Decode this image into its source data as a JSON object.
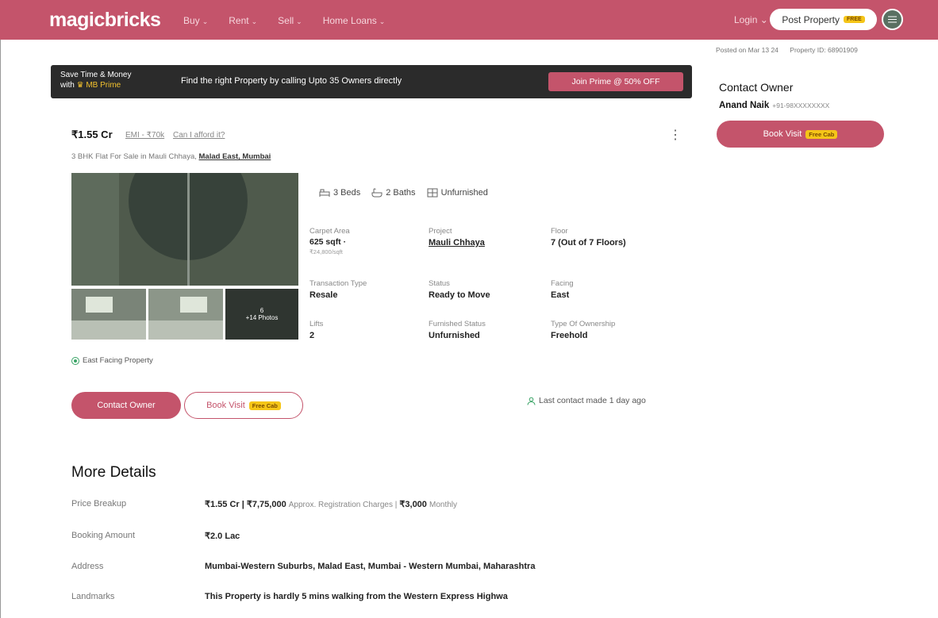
{
  "header": {
    "logo": "magicbricks",
    "nav": [
      "Buy",
      "Rent",
      "Sell",
      "Home Loans"
    ],
    "login": "Login",
    "post_property": "Post Property",
    "free_badge": "FREE"
  },
  "posted": {
    "date": "Posted on Mar 13 24",
    "property_id": "Property ID: 68901909"
  },
  "prime_banner": {
    "line1": "Save Time & Money",
    "line2_prefix": "with",
    "line2_brand": "MB Prime",
    "message": "Find the right Property by calling Upto 35 Owners directly",
    "cta": "Join Prime @ 50% OFF"
  },
  "contact_panel": {
    "title": "Contact Owner",
    "owner_name": "Anand Naik",
    "owner_phone": "+91-98XXXXXXXX",
    "book_visit": "Book Visit",
    "cab_badge": "Free Cab"
  },
  "listing": {
    "price": "₹1.55 Cr",
    "emi": "EMI - ₹70k",
    "afford": "Can I afford it?",
    "subtitle_prefix": "3 BHK Flat For Sale in Mauli Chhaya,",
    "subtitle_location": "Malad East, Mumbai",
    "photos_count": "+14 Photos",
    "photos_number": "6",
    "features": {
      "beds": "3 Beds",
      "baths": "2 Baths",
      "furnishing": "Unfurnished"
    },
    "details": {
      "carpet_area_label": "Carpet Area",
      "carpet_area_value": "625 sqft ·",
      "carpet_area_rate": "₹24,800/sqft",
      "project_label": "Project",
      "project_value": "Mauli Chhaya",
      "floor_label": "Floor",
      "floor_value": "7 (Out of 7 Floors)",
      "transaction_label": "Transaction Type",
      "transaction_value": "Resale",
      "status_label": "Status",
      "status_value": "Ready to Move",
      "facing_label": "Facing",
      "facing_value": "East",
      "lifts_label": "Lifts",
      "lifts_value": "2",
      "furnished_label": "Furnished Status",
      "furnished_value": "Unfurnished",
      "ownership_label": "Type Of Ownership",
      "ownership_value": "Freehold"
    },
    "facing_note": "East Facing Property",
    "contact_owner_btn": "Contact Owner",
    "book_visit_btn": "Book Visit",
    "cab_badge": "Free Cab",
    "last_contact": "Last contact made 1 day ago"
  },
  "more_details": {
    "title": "More Details",
    "rows": [
      {
        "key": "Price Breakup",
        "v1": "₹1.55 Cr | ₹7,75,000",
        "v2": "Approx. Registration Charges |",
        "v3": "₹3,000",
        "v4": "Monthly"
      },
      {
        "key": "Booking Amount",
        "v1": "₹2.0 Lac"
      },
      {
        "key": "Address",
        "v1": "Mumbai-Western Suburbs, Malad East, Mumbai - Western Mumbai, Maharashtra"
      },
      {
        "key": "Landmarks",
        "v1": "This Property is hardly 5 mins walking from the Western Express Highwa"
      }
    ]
  },
  "colors": {
    "brand": "#c4546b",
    "banner": "#2b2b2b",
    "badge": "#f5c518"
  }
}
